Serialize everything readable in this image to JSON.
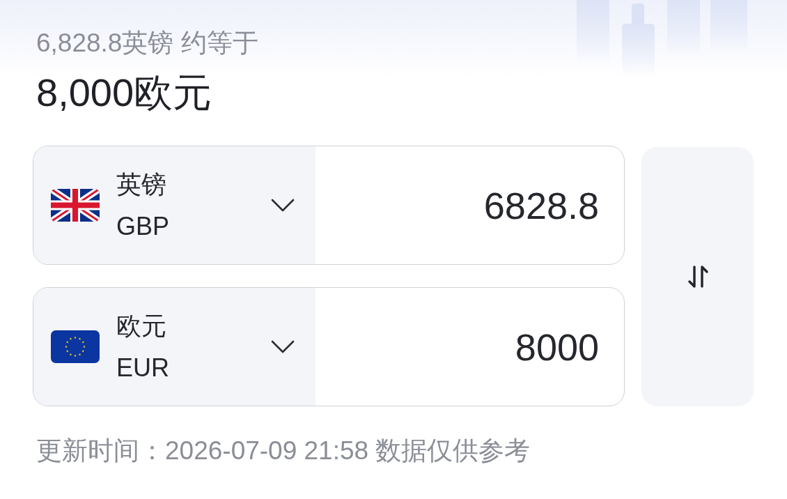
{
  "summary": {
    "subtitle": "6,828.8英镑 约等于",
    "title": "8,000欧元"
  },
  "converter": {
    "rows": [
      {
        "kind": "gb",
        "name": "英镑",
        "code": "GBP",
        "amount": "6828.8"
      },
      {
        "kind": "eu",
        "name": "欧元",
        "code": "EUR",
        "amount": "8000"
      }
    ]
  },
  "update_note": "更新时间：2026-07-09 21:58 数据仅供参考"
}
